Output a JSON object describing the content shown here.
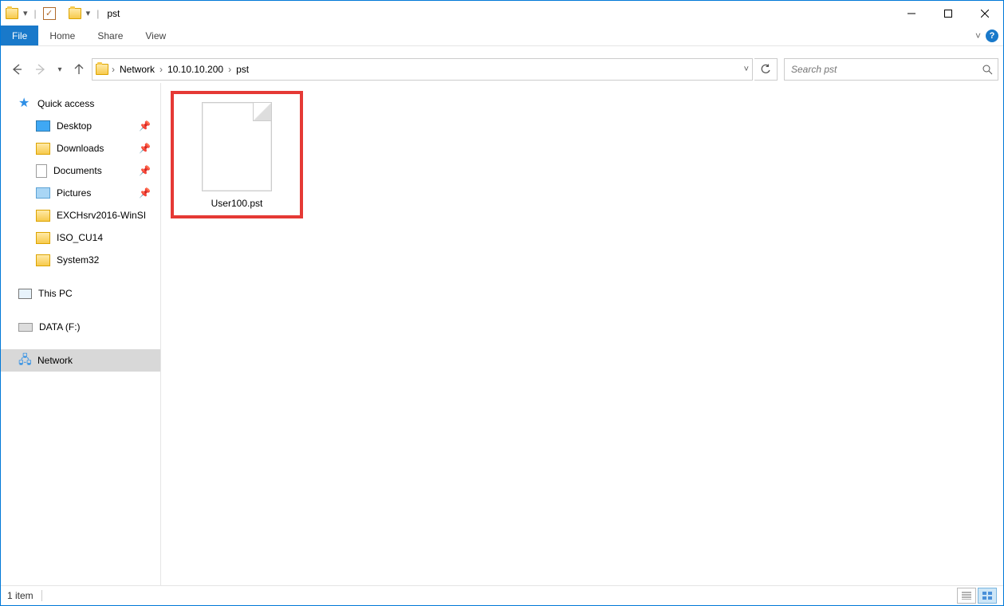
{
  "window": {
    "title": "pst"
  },
  "ribbon": {
    "file": "File",
    "tabs": [
      "Home",
      "Share",
      "View"
    ]
  },
  "address": {
    "crumbs": [
      "Network",
      "10.10.10.200",
      "pst"
    ]
  },
  "search": {
    "placeholder": "Search pst"
  },
  "tree": {
    "quick_access": "Quick access",
    "items": [
      {
        "label": "Desktop",
        "pinned": true,
        "icon": "desktop"
      },
      {
        "label": "Downloads",
        "pinned": true,
        "icon": "folder"
      },
      {
        "label": "Documents",
        "pinned": true,
        "icon": "doc"
      },
      {
        "label": "Pictures",
        "pinned": true,
        "icon": "pic"
      },
      {
        "label": "EXCHsrv2016-WinSI",
        "pinned": false,
        "icon": "folder"
      },
      {
        "label": "ISO_CU14",
        "pinned": false,
        "icon": "folder"
      },
      {
        "label": "System32",
        "pinned": false,
        "icon": "folder"
      }
    ],
    "this_pc": "This PC",
    "drive": "DATA (F:)",
    "network": "Network"
  },
  "content": {
    "file_name": "User100.pst"
  },
  "status": {
    "text": "1 item"
  }
}
